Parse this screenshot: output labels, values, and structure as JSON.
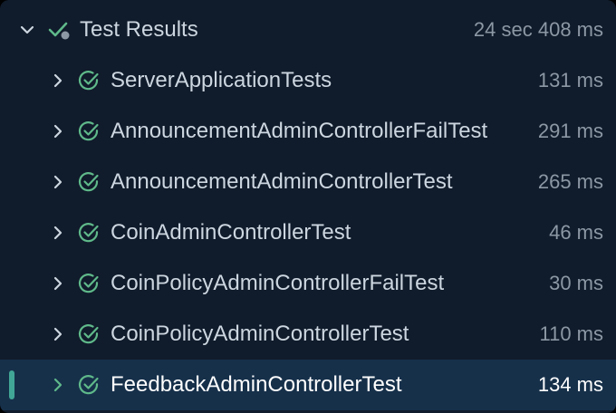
{
  "root": {
    "label": "Test Results",
    "duration": "24 sec 408 ms"
  },
  "items": [
    {
      "label": "ServerApplicationTests",
      "duration": "131 ms"
    },
    {
      "label": "AnnouncementAdminControllerFailTest",
      "duration": "291 ms"
    },
    {
      "label": "AnnouncementAdminControllerTest",
      "duration": "265 ms"
    },
    {
      "label": "CoinAdminControllerTest",
      "duration": "46 ms"
    },
    {
      "label": "CoinPolicyAdminControllerFailTest",
      "duration": "30 ms"
    },
    {
      "label": "CoinPolicyAdminControllerTest",
      "duration": "110 ms"
    },
    {
      "label": "FeedbackAdminControllerTest",
      "duration": "134 ms",
      "selected": true
    }
  ],
  "icons": {
    "expanded": "chevron-down-icon",
    "collapsed": "chevron-right-icon",
    "root_status": "passed-suite-icon",
    "item_status": "check-circle-icon"
  },
  "colors": {
    "background": "#101b2b",
    "selected_background": "#16304a",
    "selection_bar": "#41a696",
    "pass_green": "#5fb98a",
    "text": "#ccd6e0",
    "muted_text": "#8d98a5"
  }
}
